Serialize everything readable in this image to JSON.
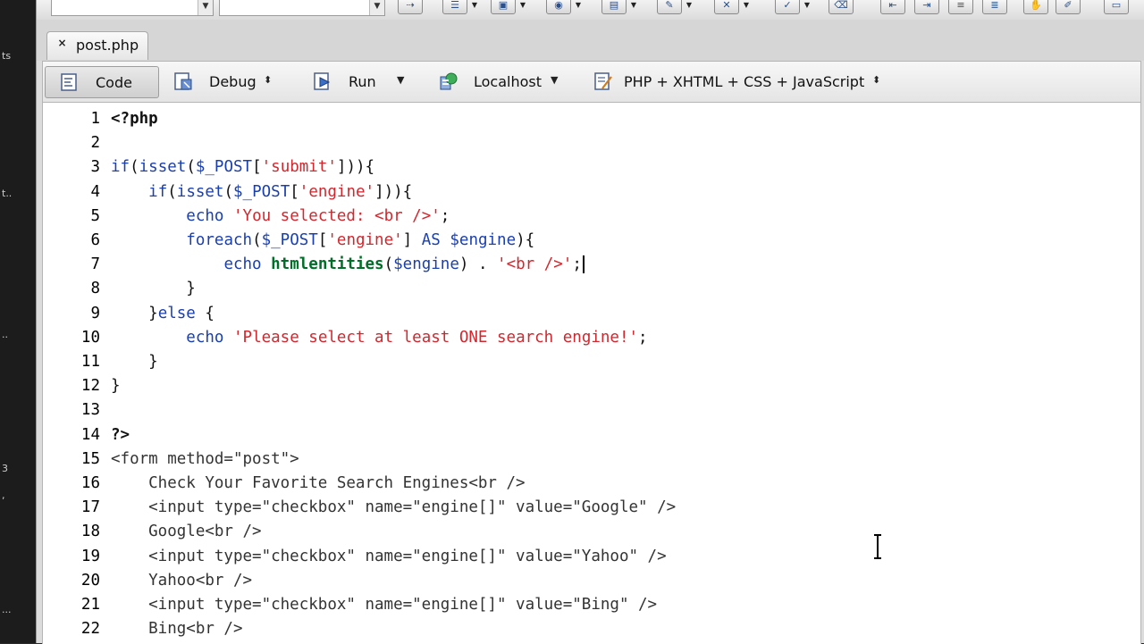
{
  "left_strip": {
    "marks": [
      "ts",
      "t..",
      "..",
      "3",
      ",",
      "..."
    ]
  },
  "tab": {
    "label": "post.php",
    "close_glyph": "×"
  },
  "doc_toolbar": {
    "code_label": "Code",
    "debug_label": "Debug",
    "run_label": "Run",
    "localhost_label": "Localhost",
    "language_label": "PHP + XHTML + CSS + JavaScript"
  },
  "editor": {
    "cursor_line": 7,
    "lines": [
      {
        "n": "1",
        "code": "<?php"
      },
      {
        "n": "2",
        "code": ""
      },
      {
        "n": "3",
        "code": "if(isset($_POST['submit'])){"
      },
      {
        "n": "4",
        "code": "    if(isset($_POST['engine'])){"
      },
      {
        "n": "5",
        "code": "        echo 'You selected: <br />';"
      },
      {
        "n": "6",
        "code": "        foreach($_POST['engine'] AS $engine){"
      },
      {
        "n": "7",
        "code": "            echo htmlentities($engine) . '<br />';"
      },
      {
        "n": "8",
        "code": "        }"
      },
      {
        "n": "9",
        "code": "    }else {"
      },
      {
        "n": "10",
        "code": "        echo 'Please select at least ONE search engine!';"
      },
      {
        "n": "11",
        "code": "    }"
      },
      {
        "n": "12",
        "code": "}"
      },
      {
        "n": "13",
        "code": ""
      },
      {
        "n": "14",
        "code": "?>"
      },
      {
        "n": "15",
        "code": "<form method=\"post\">"
      },
      {
        "n": "16",
        "code": "    Check Your Favorite Search Engines<br />"
      },
      {
        "n": "17",
        "code": "    <input type=\"checkbox\" name=\"engine[]\" value=\"Google\" />"
      },
      {
        "n": "18",
        "code": "    Google<br />"
      },
      {
        "n": "19",
        "code": "    <input type=\"checkbox\" name=\"engine[]\" value=\"Yahoo\" />"
      },
      {
        "n": "20",
        "code": "    Yahoo<br />"
      },
      {
        "n": "21",
        "code": "    <input type=\"checkbox\" name=\"engine[]\" value=\"Bing\" />"
      },
      {
        "n": "22",
        "code": "    Bing<br />"
      }
    ]
  },
  "colors": {
    "keyword": "#1a3fae",
    "string": "#d0282e",
    "function": "#006e28",
    "html": "#333333"
  },
  "icons": [
    "code-view-icon",
    "debug-icon",
    "run-icon",
    "localhost-server-icon",
    "document-language-icon",
    "i-beam-cursor-icon"
  ]
}
